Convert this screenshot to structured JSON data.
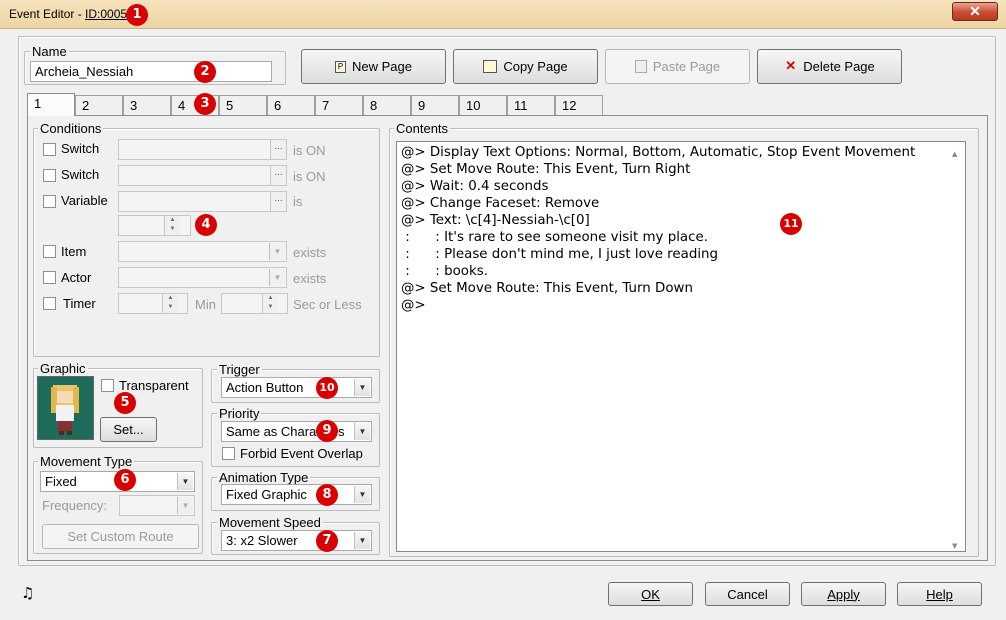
{
  "window": {
    "title_prefix": "Event Editor - ",
    "title_id": "ID:0005",
    "close_label": "✕"
  },
  "badges": [
    "1",
    "2",
    "3",
    "4",
    "5",
    "6",
    "7",
    "8",
    "9",
    "10",
    "11"
  ],
  "name": {
    "label": "Name",
    "value": "Archeia_Nessiah"
  },
  "page_buttons": {
    "new": "New Page",
    "copy": "Copy Page",
    "paste": "Paste Page",
    "delete": "Delete Page"
  },
  "tabs": [
    "1",
    "2",
    "3",
    "4",
    "5",
    "6",
    "7",
    "8",
    "9",
    "10",
    "11",
    "12"
  ],
  "conditions": {
    "label": "Conditions",
    "switch1": "Switch",
    "switch2": "Switch",
    "variable": "Variable",
    "is_on": "is ON",
    "is": "is",
    "item": "Item",
    "actor": "Actor",
    "timer": "Timer",
    "exists": "exists",
    "min": "Min",
    "sec_or_less": "Sec or Less",
    "dots": "..."
  },
  "graphic": {
    "label": "Graphic",
    "transparent": "Transparent",
    "set_button": "Set..."
  },
  "movement_type": {
    "label": "Movement Type",
    "value": "Fixed",
    "frequency_label": "Frequency:",
    "custom_route": "Set Custom Route"
  },
  "trigger": {
    "label": "Trigger",
    "value": "Action Button"
  },
  "priority": {
    "label": "Priority",
    "value": "Same as Characters",
    "forbid_overlap": "Forbid Event Overlap"
  },
  "animation_type": {
    "label": "Animation Type",
    "value": "Fixed Graphic"
  },
  "movement_speed": {
    "label": "Movement Speed",
    "value": "3: x2 Slower"
  },
  "contents": {
    "label": "Contents",
    "lines": [
      "@> Display Text Options: Normal, Bottom, Automatic, Stop Event Movement",
      "@> Set Move Route: This Event, Turn Right",
      "@> Wait: 0.4 seconds",
      "@> Change Faceset: Remove",
      "@> Text: \\c[4]-Nessiah-\\c[0]",
      " :      : It's rare to see someone visit my place.",
      " :      : Please don't mind me, I just love reading",
      " :      : books.",
      "@> Set Move Route: This Event, Turn Down",
      "@>"
    ]
  },
  "footer": {
    "ok": "OK",
    "cancel": "Cancel",
    "apply": "Apply",
    "help": "Help",
    "music_icon": "♫"
  },
  "colors": {
    "badge": "#d80000",
    "titlebar": "#f1dcb0",
    "close": "#c94a31"
  }
}
